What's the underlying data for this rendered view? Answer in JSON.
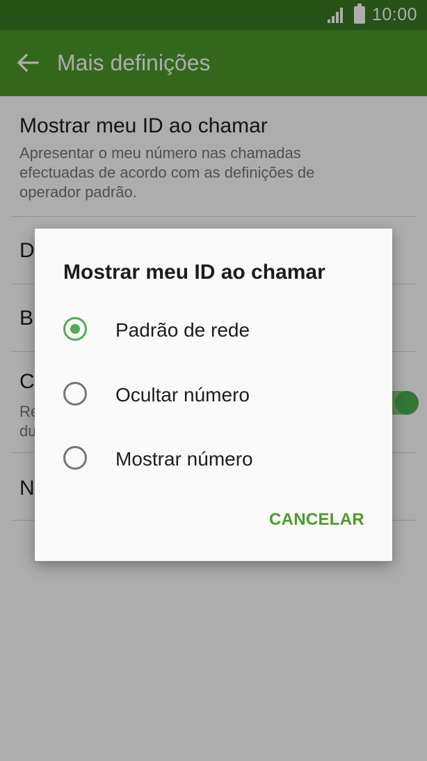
{
  "status_bar": {
    "time": "10:00"
  },
  "app_bar": {
    "title": "Mais definições",
    "back_icon": "arrow-left-icon"
  },
  "settings": {
    "items": [
      {
        "title": "Mostrar meu ID ao chamar",
        "description": "Apresentar o meu número nas chamadas efectuadas de acordo com as definições de operador padrão."
      },
      {
        "title": "D"
      },
      {
        "title": "B"
      },
      {
        "title": "C",
        "description_lines": [
          "Re",
          "du"
        ]
      },
      {
        "title": "N"
      }
    ]
  },
  "dialog": {
    "title": "Mostrar meu ID ao chamar",
    "options": [
      {
        "label": "Padrão de rede",
        "selected": true
      },
      {
        "label": "Ocultar número",
        "selected": false
      },
      {
        "label": "Mostrar número",
        "selected": false
      }
    ],
    "cancel_label": "CANCELAR"
  },
  "colors": {
    "status_bar": "#3a7a24",
    "app_bar": "#4c9a2a",
    "accent": "#4caf50"
  }
}
